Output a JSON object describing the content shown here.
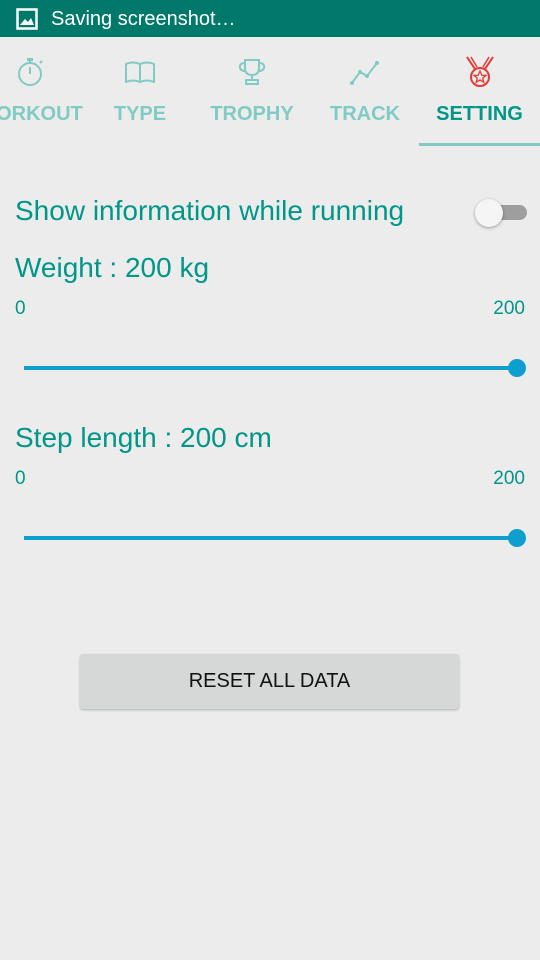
{
  "status_bar": {
    "text": "Saving screenshot…",
    "icon": "screenshot-icon"
  },
  "tabs": [
    {
      "label": "WORKOUT",
      "icon": "stopwatch-icon",
      "active": false
    },
    {
      "label": "TYPE",
      "icon": "book-icon",
      "active": false
    },
    {
      "label": "TROPHY",
      "icon": "trophy-icon",
      "active": false
    },
    {
      "label": "TRACK",
      "icon": "chart-line-icon",
      "active": false
    },
    {
      "label": "SETTING",
      "icon": "medal-icon",
      "active": true
    }
  ],
  "settings": {
    "show_info_label": "Show information while running",
    "show_info_enabled": false,
    "weight": {
      "label": "Weight :  200 kg",
      "min": "0",
      "max": "200",
      "value": 200
    },
    "step_length": {
      "label": "Step length :  200 cm",
      "min": "0",
      "max": "200",
      "value": 200
    },
    "reset_label": "RESET ALL DATA"
  },
  "colors": {
    "status_bar": "#00796b",
    "accent": "#009688",
    "tab_inactive": "#80cbc4",
    "slider": "#0e9fcf",
    "medal": "#e53935"
  }
}
